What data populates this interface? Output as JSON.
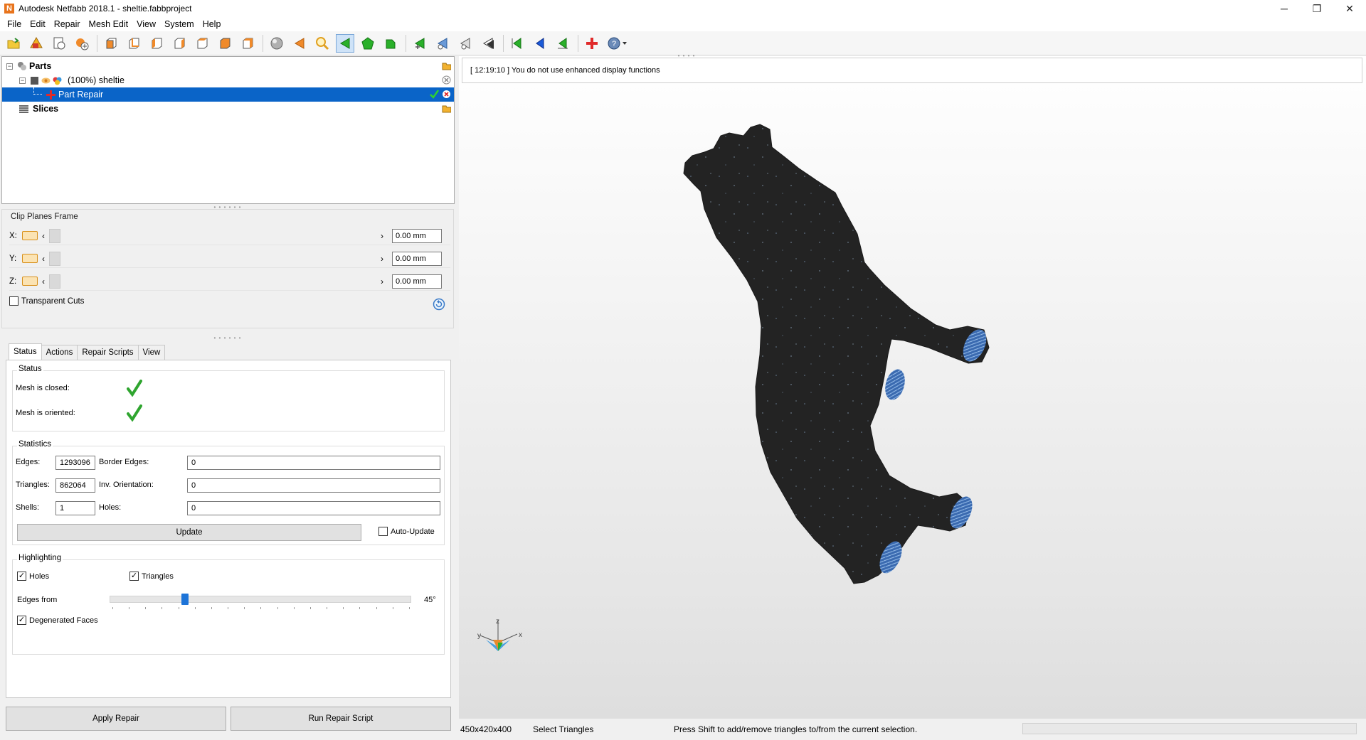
{
  "window": {
    "title": "Autodesk Netfabb 2018.1 - sheltie.fabbproject",
    "logo_letter": "N",
    "minimize": "─",
    "maximize": "❐",
    "close": "✕"
  },
  "menu": [
    "File",
    "Edit",
    "Repair",
    "Mesh Edit",
    "View",
    "System",
    "Help"
  ],
  "toolbar": {
    "icons": [
      "open-project-icon",
      "add-part-icon",
      "export-icon",
      "new-part-icon",
      "view-front-icon",
      "view-back-icon",
      "view-left-icon",
      "view-right-icon",
      "view-top-icon",
      "view-bottom-icon",
      "view-iso-icon",
      "sphere-icon",
      "arrow-icon",
      "zoom-icon",
      "select-triangle-icon",
      "select-surface-icon",
      "select-shell-icon",
      "add-triangle-icon",
      "move-icon",
      "cut-icon",
      "smooth-icon",
      "flip-left-icon",
      "flip-blue-icon",
      "flip-green-icon",
      "repair-cross-icon",
      "help-dropdown-icon"
    ]
  },
  "tree": {
    "parts_label": "Parts",
    "part_name": "(100%) sheltie",
    "repair_label": "Part Repair",
    "slices_label": "Slices"
  },
  "clip_planes": {
    "title": "Clip Planes Frame",
    "rows": [
      {
        "axis": "X:",
        "value": "0.00 mm"
      },
      {
        "axis": "Y:",
        "value": "0.00 mm"
      },
      {
        "axis": "Z:",
        "value": "0.00 mm"
      }
    ],
    "transparent_cuts_label": "Transparent Cuts",
    "transparent_cuts_checked": false
  },
  "repair": {
    "tabs": [
      "Status",
      "Actions",
      "Repair Scripts",
      "View"
    ],
    "active_tab": "Status",
    "status_group": "Status",
    "mesh_closed_label": "Mesh is closed:",
    "mesh_oriented_label": "Mesh is oriented:",
    "statistics_group": "Statistics",
    "edges_label": "Edges:",
    "edges_value": "1293096",
    "border_edges_label": "Border Edges:",
    "border_edges_value": "0",
    "triangles_label": "Triangles:",
    "triangles_value": "862064",
    "inv_orientation_label": "Inv. Orientation:",
    "inv_orientation_value": "0",
    "shells_label": "Shells:",
    "shells_value": "1",
    "holes_label": "Holes:",
    "holes_value": "0",
    "update_label": "Update",
    "auto_update_label": "Auto-Update",
    "highlighting_group": "Highlighting",
    "holes_check_label": "Holes",
    "triangles_check_label": "Triangles",
    "edges_from_label": "Edges from",
    "edges_from_value": "45°",
    "edges_from_fraction": 0.25,
    "degenerated_label": "Degenerated Faces",
    "apply_repair": "Apply Repair",
    "run_repair_script": "Run Repair Script"
  },
  "viewport": {
    "log_message": "[ 12:19:10 ] You do not use enhanced display functions",
    "axis_x": "x",
    "axis_y": "y",
    "axis_z": "z"
  },
  "statusbar": {
    "dimensions": "450x420x400",
    "mode": "Select Triangles",
    "hint": "Press Shift to add/remove triangles to/from the current selection."
  },
  "colors": {
    "selection": "#0a64c8",
    "model": "#232323",
    "highlight": "#4a7fc4",
    "check": "#2fa52f"
  }
}
